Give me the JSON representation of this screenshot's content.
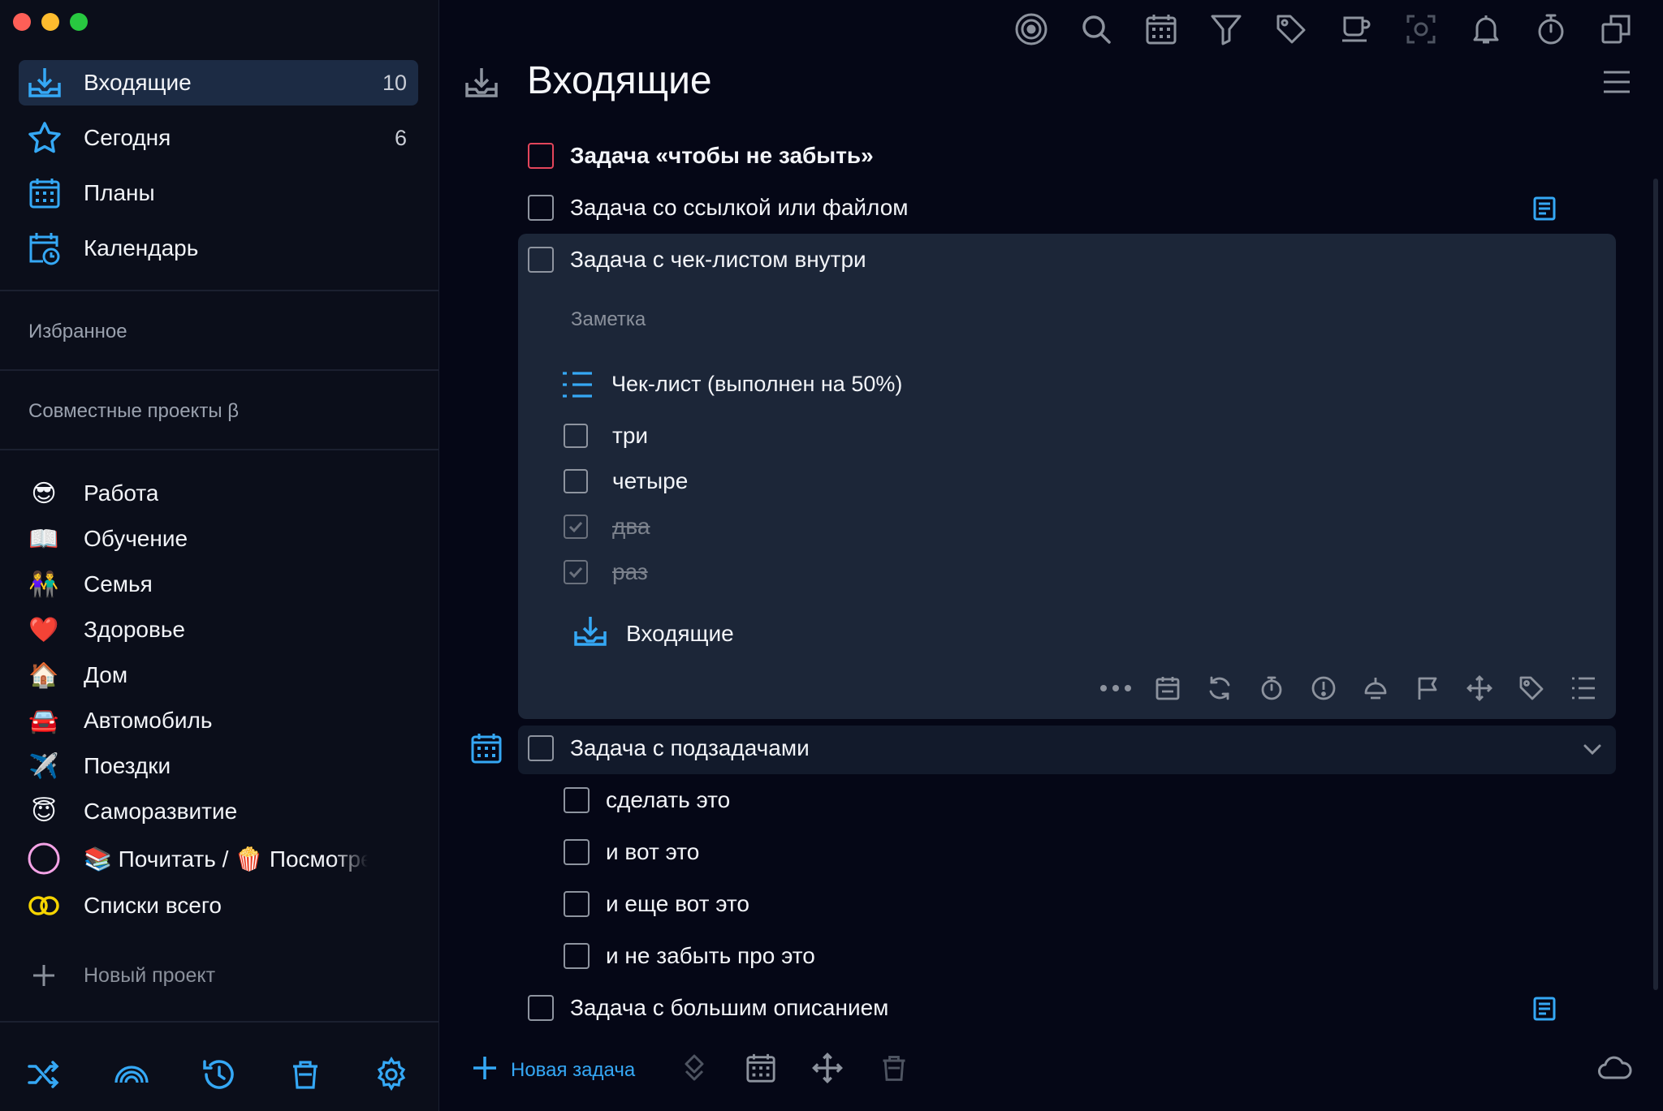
{
  "sidebar": {
    "nav": [
      {
        "label": "Входящие",
        "count": "10",
        "icon": "inbox-icon"
      },
      {
        "label": "Сегодня",
        "count": "6",
        "icon": "star-icon"
      },
      {
        "label": "Планы",
        "count": "",
        "icon": "calendar-grid-icon"
      },
      {
        "label": "Календарь",
        "count": "",
        "icon": "calendar-clock-icon"
      }
    ],
    "favorites_title": "Избранное",
    "shared_title": "Совместные проекты β",
    "projects": [
      {
        "emoji": "😎",
        "label": "Работа"
      },
      {
        "emoji": "📖",
        "label": "Обучение"
      },
      {
        "emoji": "👫",
        "label": "Семья"
      },
      {
        "emoji": "❤️",
        "label": "Здоровье"
      },
      {
        "emoji": "🏠",
        "label": "Дом"
      },
      {
        "emoji": "🚘",
        "label": "Автомобиль"
      },
      {
        "emoji": "✈️",
        "label": "Поездки"
      },
      {
        "emoji": "😇",
        "label": "Саморазвитие"
      },
      {
        "emoji": "",
        "label": "📚 Почитать / 🍿 Посмотреть"
      },
      {
        "emoji": "",
        "label": "Списки всего"
      }
    ],
    "new_project": "Новый проект",
    "bottom_tools": [
      "shuffle-icon",
      "rainbow-icon",
      "history-icon",
      "trash-icon",
      "settings-icon"
    ]
  },
  "toolbar_icons": [
    "focus-icon",
    "search-icon",
    "calendar-icon",
    "filter-icon",
    "tag-icon",
    "coffee-icon",
    "screenshot-icon",
    "bell-icon",
    "timer-icon",
    "windows-icon"
  ],
  "main": {
    "title": "Входящие",
    "tasks": [
      {
        "text": "Задача «чтобы не забыть»"
      },
      {
        "text": "Задача со ссылкой или файлом"
      },
      {
        "text": "Задача с чек-листом внутри"
      }
    ],
    "expanded": {
      "note_placeholder": "Заметка",
      "checklist_title": "Чек-лист (выполнен на 50%)",
      "items": [
        {
          "text": "три",
          "done": false
        },
        {
          "text": "четыре",
          "done": false
        },
        {
          "text": "два",
          "done": true
        },
        {
          "text": "раз",
          "done": true
        }
      ],
      "project": "Входящие"
    },
    "subtask_parent": "Задача с подзадачами",
    "subtasks": [
      "сделать это",
      "и вот это",
      "и еще вот это",
      "и не забыть про это"
    ],
    "last_task": "Задача с большим описанием",
    "new_task": "Новая задача"
  },
  "colors": {
    "accent": "#35a8f5",
    "red": "#e3455b",
    "bg": "#050716",
    "card": "#1c2638"
  }
}
